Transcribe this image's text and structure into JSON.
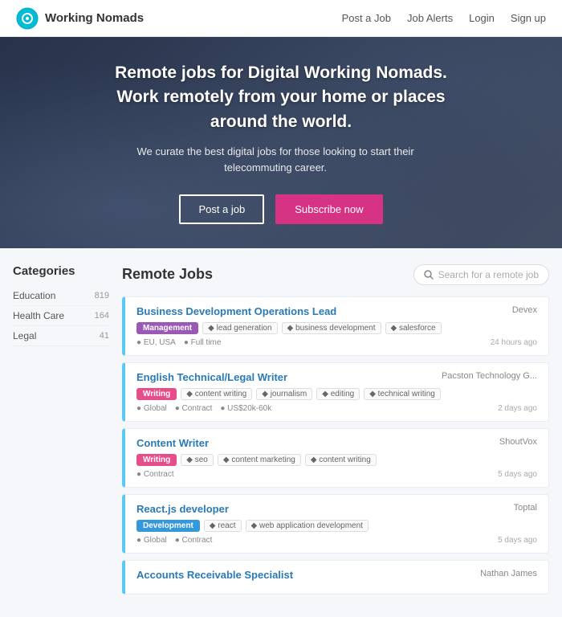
{
  "navbar": {
    "brand_name": "Working Nomads",
    "links": [
      {
        "label": "Post a Job",
        "id": "post-job"
      },
      {
        "label": "Job Alerts",
        "id": "job-alerts"
      },
      {
        "label": "Login",
        "id": "login"
      },
      {
        "label": "Sign up",
        "id": "signup"
      }
    ]
  },
  "hero": {
    "headline": "Remote jobs for Digital Working Nomads.\nWork remotely from your home or places\naround the world.",
    "subtext": "We curate the best digital jobs for those looking to start their telecommuting career.",
    "btn_post": "Post a job",
    "btn_subscribe": "Subscribe now"
  },
  "sidebar": {
    "title": "Categories",
    "items": [
      {
        "label": "Education",
        "count": "819"
      },
      {
        "label": "Health Care",
        "count": "164"
      },
      {
        "label": "Legal",
        "count": "41"
      }
    ]
  },
  "jobs_section": {
    "title": "Remote Jobs",
    "search_placeholder": "Search for a remote job",
    "jobs": [
      {
        "title": "Business Development Operations Lead",
        "company": "Devex",
        "badge_label": "Management",
        "badge_type": "management",
        "tags": [
          "lead generation",
          "business development",
          "salesforce"
        ],
        "meta": [
          "EU, USA",
          "Full time"
        ],
        "time": "24 hours ago"
      },
      {
        "title": "English Technical/Legal Writer",
        "company": "Pacston Technology G...",
        "badge_label": "Writing",
        "badge_type": "writing",
        "tags": [
          "content writing",
          "journalism",
          "editing",
          "technical writing"
        ],
        "meta": [
          "Global",
          "Contract",
          "US$20k-60k"
        ],
        "time": "2 days ago"
      },
      {
        "title": "Content Writer",
        "company": "ShoutVox",
        "badge_label": "Writing",
        "badge_type": "writing",
        "tags": [
          "seo",
          "content marketing",
          "content writing"
        ],
        "meta": [
          "Contract"
        ],
        "time": "5 days ago"
      },
      {
        "title": "React.js developer",
        "company": "Toptal",
        "badge_label": "Development",
        "badge_type": "development",
        "tags": [
          "react",
          "web application development"
        ],
        "meta": [
          "Global",
          "Contract"
        ],
        "time": "5 days ago"
      },
      {
        "title": "Accounts Receivable Specialist",
        "company": "Nathan James",
        "badge_label": "",
        "badge_type": "",
        "tags": [],
        "meta": [],
        "time": ""
      }
    ]
  }
}
